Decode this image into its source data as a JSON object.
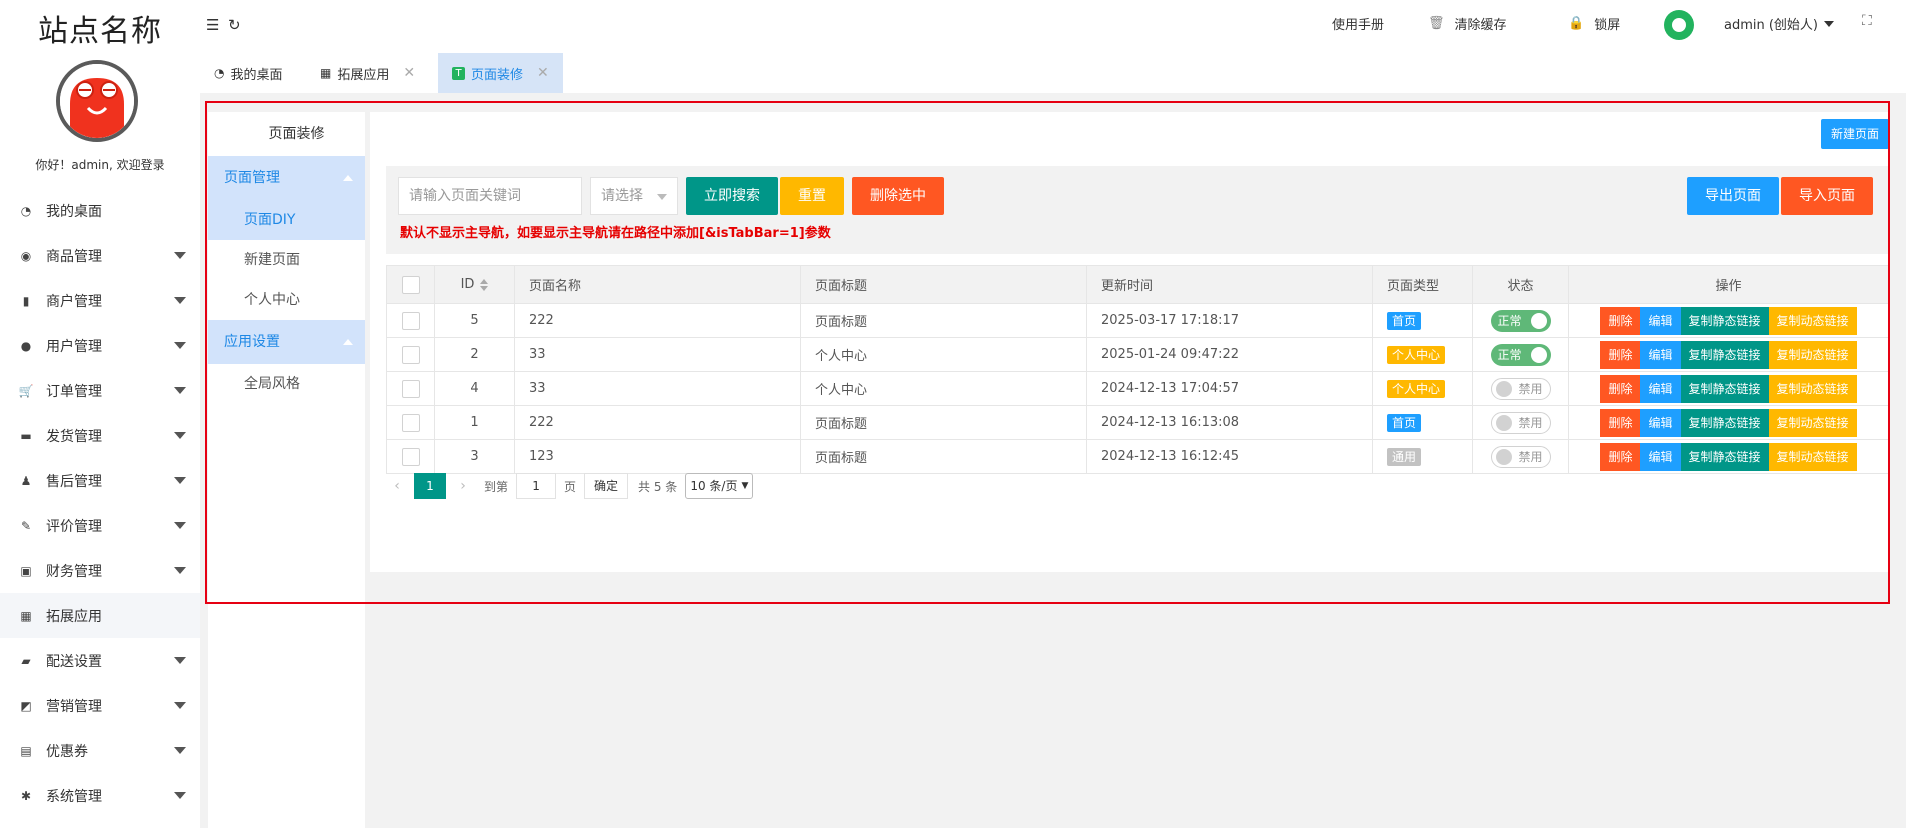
{
  "site": {
    "title": "站点名称",
    "greeting": "你好！admin, 欢迎登录"
  },
  "sidebar": {
    "items": [
      {
        "label": "我的桌面",
        "icon": "dashboard-icon",
        "caret": false,
        "active": false
      },
      {
        "label": "商品管理",
        "icon": "goods-icon",
        "caret": true,
        "active": false
      },
      {
        "label": "商户管理",
        "icon": "merchant-icon",
        "caret": true,
        "active": false
      },
      {
        "label": "用户管理",
        "icon": "user-icon",
        "caret": true,
        "active": false
      },
      {
        "label": "订单管理",
        "icon": "cart-icon",
        "caret": true,
        "active": false
      },
      {
        "label": "发货管理",
        "icon": "truck-icon",
        "caret": true,
        "active": false
      },
      {
        "label": "售后管理",
        "icon": "service-icon",
        "caret": true,
        "active": false
      },
      {
        "label": "评价管理",
        "icon": "edit-icon",
        "caret": true,
        "active": false
      },
      {
        "label": "财务管理",
        "icon": "money-icon",
        "caret": true,
        "active": false
      },
      {
        "label": "拓展应用",
        "icon": "apps-icon",
        "caret": false,
        "active": true
      },
      {
        "label": "配送设置",
        "icon": "delivery-icon",
        "caret": true,
        "active": false
      },
      {
        "label": "营销管理",
        "icon": "marketing-icon",
        "caret": true,
        "active": false
      },
      {
        "label": "优惠券",
        "icon": "coupon-icon",
        "caret": true,
        "active": false
      },
      {
        "label": "系统管理",
        "icon": "gear-icon",
        "caret": true,
        "active": false
      }
    ]
  },
  "header": {
    "manual": "使用手册",
    "clear_cache": "清除缓存",
    "lock": "锁屏",
    "user": "admin (创始人)"
  },
  "tabs": [
    {
      "label": "我的桌面",
      "icon": "dashboard-icon",
      "closable": false,
      "active": false
    },
    {
      "label": "拓展应用",
      "icon": "apps-icon",
      "closable": true,
      "active": false
    },
    {
      "label": "页面装修",
      "icon": "decorate-icon",
      "closable": true,
      "active": true
    }
  ],
  "subnav": {
    "title": "页面装修",
    "groups": [
      {
        "label": "页面管理",
        "items": [
          {
            "label": "页面DIY",
            "active": true
          },
          {
            "label": "新建页面",
            "active": false
          },
          {
            "label": "个人中心",
            "active": false
          }
        ]
      },
      {
        "label": "应用设置",
        "items": [
          {
            "label": "全局风格",
            "active": false
          }
        ]
      }
    ]
  },
  "toolbar": {
    "new_page": "新建页面",
    "search_placeholder": "请输入页面关键词",
    "select_placeholder": "请选择",
    "search_btn": "立即搜索",
    "reset_btn": "重置",
    "delete_selected_btn": "删除选中",
    "export_btn": "导出页面",
    "import_btn": "导入页面",
    "notice": "默认不显示主导航，如要显示主导航请在路径中添加[&isTabBar=1]参数"
  },
  "table": {
    "headers": {
      "id": "ID",
      "name": "页面名称",
      "title": "页面标题",
      "updated": "更新时间",
      "type": "页面类型",
      "status": "状态",
      "ops": "操作"
    },
    "ops": {
      "delete": "删除",
      "edit": "编辑",
      "copy_static": "复制静态链接",
      "copy_dynamic": "复制动态链接"
    },
    "rows": [
      {
        "id": "5",
        "name": "222",
        "title": "页面标题",
        "updated": "2025-03-17 17:18:17",
        "type": "首页",
        "type_color": "#1e9fff",
        "status": "正常",
        "enabled": true
      },
      {
        "id": "2",
        "name": "33",
        "title": "个人中心",
        "updated": "2025-01-24 09:47:22",
        "type": "个人中心",
        "type_color": "#ffb800",
        "status": "正常",
        "enabled": true
      },
      {
        "id": "4",
        "name": "33",
        "title": "个人中心",
        "updated": "2024-12-13 17:04:57",
        "type": "个人中心",
        "type_color": "#ffb800",
        "status": "禁用",
        "enabled": false
      },
      {
        "id": "1",
        "name": "222",
        "title": "页面标题",
        "updated": "2024-12-13 16:13:08",
        "type": "首页",
        "type_color": "#1e9fff",
        "status": "禁用",
        "enabled": false
      },
      {
        "id": "3",
        "name": "123",
        "title": "页面标题",
        "updated": "2024-12-13 16:12:45",
        "type": "通用",
        "type_color": "#c2c2c2",
        "status": "禁用",
        "enabled": false
      }
    ]
  },
  "pager": {
    "current": "1",
    "goto_label": "到第",
    "page_value": "1",
    "page_unit": "页",
    "confirm": "确定",
    "total": "共 5 条",
    "per_page": "10 条/页"
  },
  "colors": {
    "primary": "#009688",
    "warm": "#ffb800",
    "danger": "#ff5722",
    "blue": "#1e9fff",
    "frame": "#e60012"
  }
}
